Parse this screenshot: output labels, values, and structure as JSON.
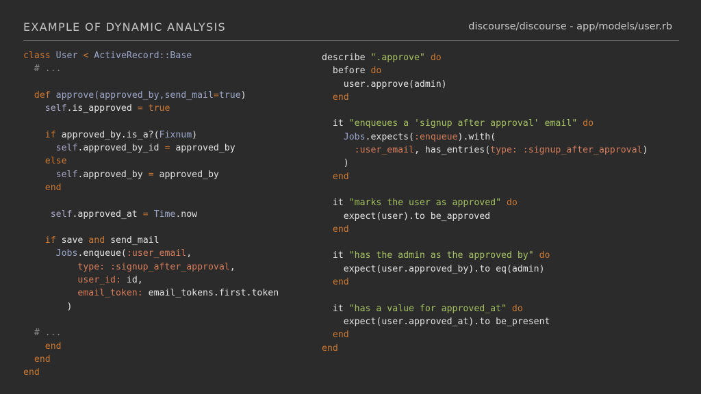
{
  "header": {
    "title": "EXAMPLE OF DYNAMIC ANALYSIS",
    "source": "discourse/discourse - app/models/user.rb"
  },
  "colors": {
    "background": "#2b2b2b",
    "keyword": "#cc7832",
    "constant": "#9ba6c9",
    "symbol": "#d37c5a",
    "string": "#a5c261",
    "comment": "#8a8a8a"
  },
  "left_code": [
    [
      [
        "keyword",
        "class"
      ],
      [
        "plain",
        " "
      ],
      [
        "const",
        "User"
      ],
      [
        "plain",
        " "
      ],
      [
        "keyword",
        "<"
      ],
      [
        "plain",
        " "
      ],
      [
        "const",
        "ActiveRecord::Base"
      ]
    ],
    [
      [
        "plain",
        "  "
      ],
      [
        "comment",
        "# ..."
      ]
    ],
    [],
    [
      [
        "plain",
        "  "
      ],
      [
        "keyword",
        "def"
      ],
      [
        "plain",
        " "
      ],
      [
        "const",
        "approve(approved_by,send_mail"
      ],
      [
        "keyword",
        "="
      ],
      [
        "const",
        "true"
      ],
      [
        "plain",
        ")"
      ]
    ],
    [
      [
        "plain",
        "    "
      ],
      [
        "self",
        "self"
      ],
      [
        "plain",
        ".is_approved "
      ],
      [
        "keyword",
        "="
      ],
      [
        "plain",
        " "
      ],
      [
        "keyword",
        "true"
      ]
    ],
    [],
    [
      [
        "plain",
        "    "
      ],
      [
        "keyword",
        "if"
      ],
      [
        "plain",
        " approved_by.is_a?("
      ],
      [
        "const",
        "Fixnum"
      ],
      [
        "plain",
        ")"
      ]
    ],
    [
      [
        "plain",
        "      "
      ],
      [
        "self",
        "self"
      ],
      [
        "plain",
        ".approved_by_id "
      ],
      [
        "keyword",
        "="
      ],
      [
        "plain",
        " approved_by"
      ]
    ],
    [
      [
        "plain",
        "    "
      ],
      [
        "keyword",
        "else"
      ]
    ],
    [
      [
        "plain",
        "      "
      ],
      [
        "self",
        "self"
      ],
      [
        "plain",
        ".approved_by "
      ],
      [
        "keyword",
        "="
      ],
      [
        "plain",
        " approved_by"
      ]
    ],
    [
      [
        "plain",
        "    "
      ],
      [
        "keyword",
        "end"
      ]
    ],
    [],
    [
      [
        "plain",
        "     "
      ],
      [
        "self",
        "self"
      ],
      [
        "plain",
        ".approved_at "
      ],
      [
        "keyword",
        "="
      ],
      [
        "plain",
        " "
      ],
      [
        "const",
        "Time"
      ],
      [
        "plain",
        ".now"
      ]
    ],
    [],
    [
      [
        "plain",
        "    "
      ],
      [
        "keyword",
        "if"
      ],
      [
        "plain",
        " save "
      ],
      [
        "keyword",
        "and"
      ],
      [
        "plain",
        " send_mail"
      ]
    ],
    [
      [
        "plain",
        "      "
      ],
      [
        "const",
        "Jobs"
      ],
      [
        "plain",
        ".enqueue("
      ],
      [
        "symbol",
        ":user_email"
      ],
      [
        "plain",
        ","
      ]
    ],
    [
      [
        "plain",
        "          "
      ],
      [
        "symbol",
        "type: :signup_after_approval"
      ],
      [
        "plain",
        ","
      ]
    ],
    [
      [
        "plain",
        "          "
      ],
      [
        "symbol",
        "user_id:"
      ],
      [
        "plain",
        " id,"
      ]
    ],
    [
      [
        "plain",
        "          "
      ],
      [
        "symbol",
        "email_token:"
      ],
      [
        "plain",
        " email_tokens.first.token"
      ]
    ],
    [
      [
        "plain",
        "        )"
      ]
    ],
    [],
    [
      [
        "plain",
        "  "
      ],
      [
        "comment",
        "# ..."
      ]
    ],
    [
      [
        "plain",
        "    "
      ],
      [
        "keyword",
        "end"
      ]
    ],
    [
      [
        "plain",
        "  "
      ],
      [
        "keyword",
        "end"
      ]
    ],
    [
      [
        "keyword",
        "end"
      ]
    ]
  ],
  "right_code": [
    [
      [
        "plain",
        "describe "
      ],
      [
        "string",
        "\".approve\""
      ],
      [
        "plain",
        " "
      ],
      [
        "keyword",
        "do"
      ]
    ],
    [
      [
        "plain",
        "  before "
      ],
      [
        "keyword",
        "do"
      ]
    ],
    [
      [
        "plain",
        "    user.approve(admin)"
      ]
    ],
    [
      [
        "plain",
        "  "
      ],
      [
        "keyword",
        "end"
      ]
    ],
    [],
    [
      [
        "plain",
        "  it "
      ],
      [
        "string",
        "\"enqueues a 'signup after approval' email\""
      ],
      [
        "plain",
        " "
      ],
      [
        "keyword",
        "do"
      ]
    ],
    [
      [
        "plain",
        "    "
      ],
      [
        "const",
        "Jobs"
      ],
      [
        "plain",
        ".expects("
      ],
      [
        "symbol",
        ":enqueue"
      ],
      [
        "plain",
        ").with("
      ]
    ],
    [
      [
        "plain",
        "      "
      ],
      [
        "symbol",
        ":user_email"
      ],
      [
        "plain",
        ", has_entries("
      ],
      [
        "symbol",
        "type: :signup_after_approval"
      ],
      [
        "plain",
        ")"
      ]
    ],
    [
      [
        "plain",
        "    )"
      ]
    ],
    [
      [
        "plain",
        "  "
      ],
      [
        "keyword",
        "end"
      ]
    ],
    [],
    [
      [
        "plain",
        "  it "
      ],
      [
        "string",
        "\"marks the user as approved\""
      ],
      [
        "plain",
        " "
      ],
      [
        "keyword",
        "do"
      ]
    ],
    [
      [
        "plain",
        "    expect(user).to be_approved"
      ]
    ],
    [
      [
        "plain",
        "  "
      ],
      [
        "keyword",
        "end"
      ]
    ],
    [],
    [
      [
        "plain",
        "  it "
      ],
      [
        "string",
        "\"has the admin as the approved by\""
      ],
      [
        "plain",
        " "
      ],
      [
        "keyword",
        "do"
      ]
    ],
    [
      [
        "plain",
        "    expect(user.approved_by).to eq(admin)"
      ]
    ],
    [
      [
        "plain",
        "  "
      ],
      [
        "keyword",
        "end"
      ]
    ],
    [],
    [
      [
        "plain",
        "  it "
      ],
      [
        "string",
        "\"has a value for approved_at\""
      ],
      [
        "plain",
        " "
      ],
      [
        "keyword",
        "do"
      ]
    ],
    [
      [
        "plain",
        "    expect(user.approved_at).to be_present"
      ]
    ],
    [
      [
        "plain",
        "  "
      ],
      [
        "keyword",
        "end"
      ]
    ],
    [
      [
        "keyword",
        "end"
      ]
    ]
  ]
}
